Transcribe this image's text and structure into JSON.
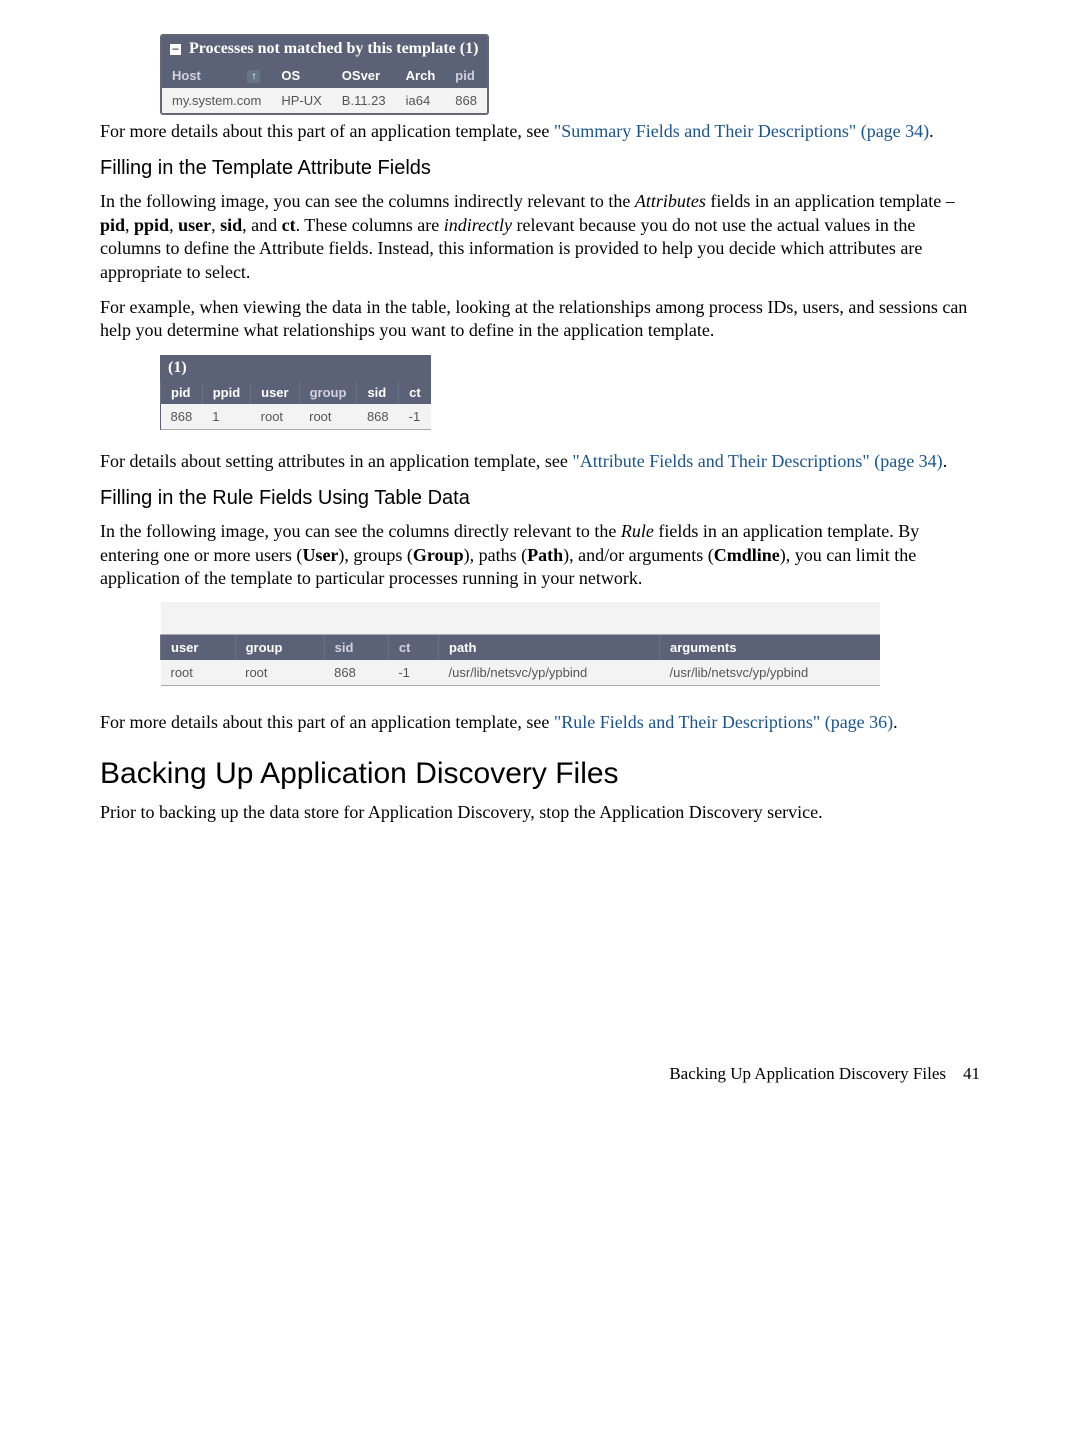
{
  "table1": {
    "title": "Processes not matched by this template (1)",
    "headers": [
      "Host",
      "OS",
      "OSver",
      "Arch",
      "pid"
    ],
    "row": [
      "my.system.com",
      "HP-UX",
      "B.11.23",
      "ia64",
      "868"
    ]
  },
  "para1a": "For more details about this part of an application template, see ",
  "link1": "\"Summary Fields and Their Descriptions\" (page 34)",
  "para1b": ".",
  "subhead1": "Filling in the Template Attribute Fields",
  "para2": "In the following image, you can see the columns indirectly relevant to the ",
  "para2_i1": "Attributes",
  "para2_mid": " fields in an application template – ",
  "para2_b1": "pid",
  "para2_c": ", ",
  "para2_b2": "ppid",
  "para2_b3": "user",
  "para2_b4": "sid",
  "para2_and": ", and ",
  "para2_b5": "ct",
  "para2_after": ". These columns are ",
  "para2_i2": "indirectly",
  "para2_end": " relevant because you do not use the actual values in the columns to define the Attribute fields. Instead, this information is provided to help you decide which attributes are appropriate to select.",
  "para3": "For example, when viewing the data in the table, looking at the relationships among process IDs, users, and sessions can help you determine what relationships you want to define in the application template.",
  "table2": {
    "caption": "(1)",
    "headers": [
      "pid",
      "ppid",
      "user",
      "group",
      "sid",
      "ct"
    ],
    "row": [
      "868",
      "1",
      "root",
      "root",
      "868",
      "-1"
    ]
  },
  "para4a": "For details about setting attributes in an application template, see ",
  "link2": "\"Attribute Fields and Their Descriptions\" (page 34)",
  "para4b": ".",
  "subhead2": "Filling in the Rule Fields Using Table Data",
  "para5a": "In the following image, you can see the columns directly relevant to the ",
  "para5_i": "Rule",
  "para5b": " fields in an application template. By entering one or more users (",
  "para5_b1": "User",
  "para5c": "), groups (",
  "para5_b2": "Group",
  "para5d": "), paths (",
  "para5_b3": "Path",
  "para5e": "), and/or arguments (",
  "para5_b4": "Cmdline",
  "para5f": "), you can limit the application of the template to particular processes running in your network.",
  "table3": {
    "headers": [
      "user",
      "group",
      "sid",
      "ct",
      "path",
      "arguments"
    ],
    "row": [
      "root",
      "root",
      "868",
      "-1",
      "/usr/lib/netsvc/yp/ypbind",
      "/usr/lib/netsvc/yp/ypbind"
    ]
  },
  "para6a": "For more details about this part of an application template, see ",
  "link3": "\"Rule Fields and Their Descriptions\" (page 36)",
  "para6b": ".",
  "mainhead": "Backing Up Application Discovery Files",
  "para7": "Prior to backing up the data store for Application Discovery, stop the Application Discovery service.",
  "footer_text": "Backing Up Application Discovery Files",
  "footer_page": "41"
}
